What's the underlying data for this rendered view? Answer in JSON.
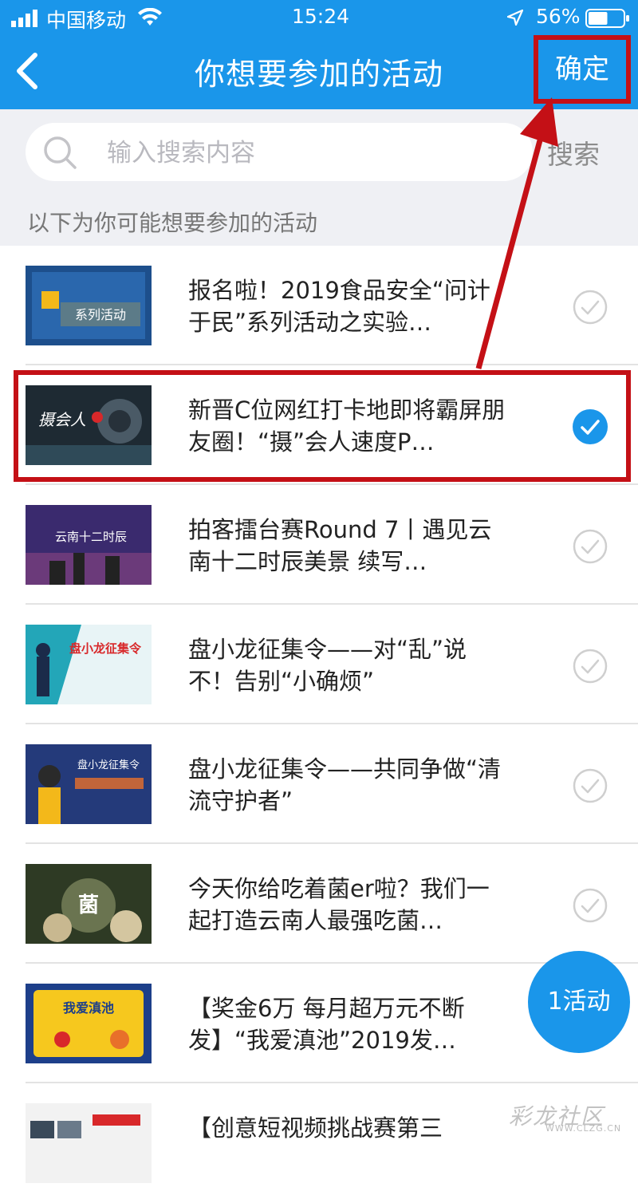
{
  "status_bar": {
    "carrier": "中国移动",
    "time": "15:24",
    "battery": "56%",
    "battery_level": 0.56
  },
  "nav": {
    "title": "你想要参加的活动",
    "confirm_label": "确定"
  },
  "search": {
    "placeholder": "输入搜索内容",
    "button_label": "搜索"
  },
  "section_header": "以下为你可能想要参加的活动",
  "activities": [
    {
      "title": "报名啦！2019食品安全“问计于民”系列活动之实验…",
      "selected": false,
      "thumb_text": "系列活动"
    },
    {
      "title": "新晋C位网红打卡地即将霸屏朋友圈！“摄”会人速度P…",
      "selected": true,
      "thumb_text": "摄会人"
    },
    {
      "title": "拍客擂台赛Round 7丨遇见云南十二时辰美景 续写…",
      "selected": false,
      "thumb_text": "云南十二时辰"
    },
    {
      "title": "盘小龙征集令——对“乱”说不！告别“小确烦”",
      "selected": false,
      "thumb_text": "盘小龙征集令"
    },
    {
      "title": "盘小龙征集令——共同争做“清流守护者”",
      "selected": false,
      "thumb_text": "盘小龙征集令"
    },
    {
      "title": "今天你给吃着菌er啦？我们一起打造云南人最强吃菌…",
      "selected": false,
      "thumb_text": "菌"
    },
    {
      "title": "【奖金6万 每月超万元不断发】“我爱滇池”2019发…",
      "selected": false,
      "thumb_text": "我爱滇池"
    },
    {
      "title": "【创意短视频挑战赛第三",
      "selected": false,
      "thumb_text": ""
    }
  ],
  "fab_label": "1活动",
  "watermark": {
    "line1": "彩龙社区",
    "line2": "WWW.CLZG.CN"
  },
  "colors": {
    "primary": "#1a96ea",
    "highlight": "#c41016",
    "background": "#eff0f4"
  }
}
